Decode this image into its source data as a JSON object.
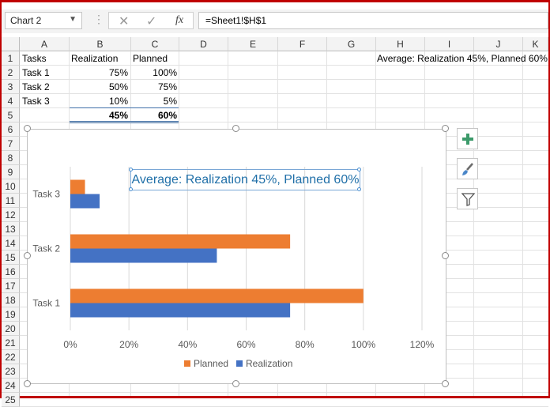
{
  "namebox": {
    "value": "Chart 2"
  },
  "formula": {
    "value": "=Sheet1!$H$1"
  },
  "columns": [
    "A",
    "B",
    "C",
    "D",
    "E",
    "F",
    "G",
    "H",
    "I",
    "J",
    "K"
  ],
  "rows": [
    "1",
    "2",
    "3",
    "4",
    "5",
    "6",
    "7",
    "8",
    "9",
    "10",
    "11",
    "12",
    "13",
    "14",
    "15",
    "16",
    "17",
    "18",
    "19",
    "20",
    "21",
    "22",
    "23",
    "24",
    "25"
  ],
  "sheet": {
    "header": {
      "tasks": "Tasks",
      "realization": "Realization",
      "planned": "Planned"
    },
    "task_rows": [
      {
        "task": "Task 1",
        "realization": "75%",
        "planned": "100%"
      },
      {
        "task": "Task 2",
        "realization": "50%",
        "planned": "75%"
      },
      {
        "task": "Task 3",
        "realization": "10%",
        "planned": "5%"
      }
    ],
    "totals": {
      "realization": "45%",
      "planned": "60%"
    },
    "h1": "Average: Realization 45%, Planned 60%"
  },
  "icons": {
    "add": "plus-icon",
    "style": "brush-icon",
    "filter": "filter-icon"
  },
  "colors": {
    "planned": "#ed7d31",
    "realization": "#4472c4",
    "accent_red": "#c00000",
    "title": "#1f6fa8"
  },
  "chart_data": {
    "type": "bar",
    "title": "Average: Realization 45%, Planned 60%",
    "categories": [
      "Task 1",
      "Task 2",
      "Task 3"
    ],
    "series": [
      {
        "name": "Planned",
        "values": [
          100,
          75,
          5
        ]
      },
      {
        "name": "Realization",
        "values": [
          75,
          50,
          10
        ]
      }
    ],
    "xlim": [
      0,
      120
    ],
    "xticks": [
      "0%",
      "20%",
      "40%",
      "60%",
      "80%",
      "100%",
      "120%"
    ],
    "grid": true,
    "legend": "bottom"
  }
}
